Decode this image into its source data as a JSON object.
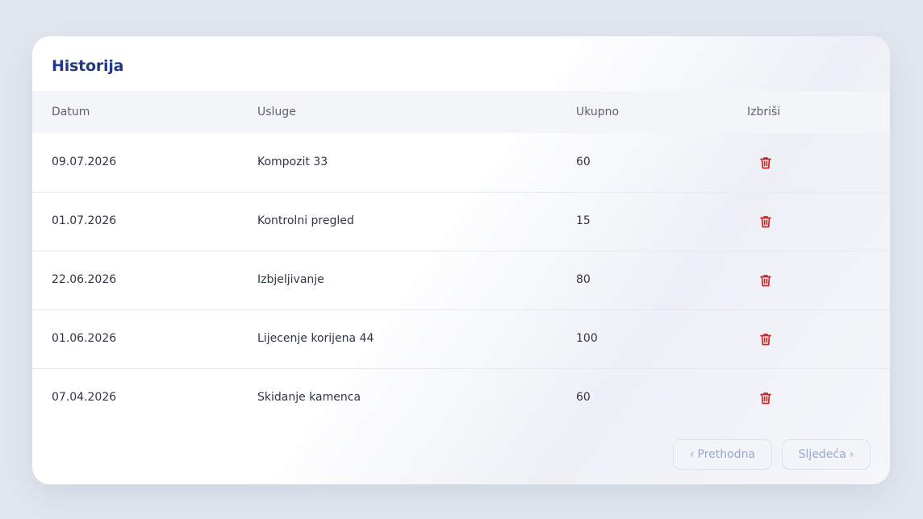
{
  "title": "Historija",
  "columns": {
    "date": "Datum",
    "services": "Usluge",
    "total": "Ukupno",
    "delete": "Izbriši"
  },
  "rows": [
    {
      "date": "09.07.2026",
      "service": "Kompozit 33",
      "total": "60"
    },
    {
      "date": "01.07.2026",
      "service": "Kontrolni pregled",
      "total": "15"
    },
    {
      "date": "22.06.2026",
      "service": "Izbjeljivanje",
      "total": "80"
    },
    {
      "date": "01.06.2026",
      "service": "Lijecenje korijena 44",
      "total": "100"
    },
    {
      "date": "07.04.2026",
      "service": "Skidanje kamenca",
      "total": "60"
    }
  ],
  "pagination": {
    "prev_label": "Prethodna",
    "next_label": "Sljedeća",
    "prev_icon": "chevron-left-icon",
    "next_icon": "chevron-right-icon"
  },
  "icons": {
    "delete": "trash-icon"
  },
  "colors": {
    "title": "#223a86",
    "trash": "#c62828",
    "pager_text": "#9aa7cc"
  }
}
